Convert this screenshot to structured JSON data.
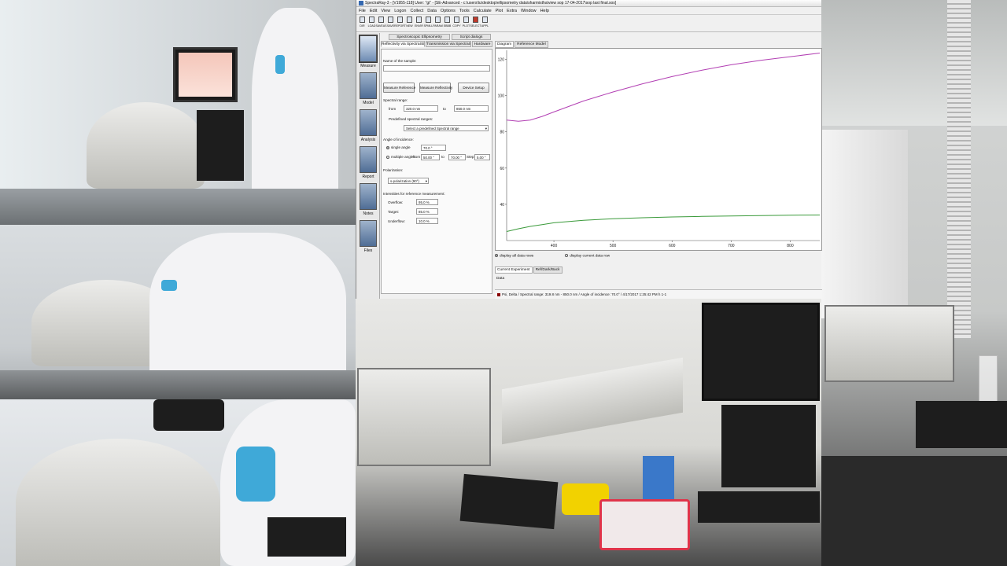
{
  "window": {
    "title": "SpectraRay-3 - [V1955-118] User: \"gi\" - [SE-Advanced - c:\\users\\lu\\desktop\\ellipsometry data\\sharmistha\\view sop 17-04-2017\\sop last final.sos]"
  },
  "menu": [
    "File",
    "Edit",
    "View",
    "Logon",
    "Collect",
    "Data",
    "Options",
    "Tools",
    "Calculate",
    "Plot",
    "Extra",
    "Window",
    "Help"
  ],
  "toolbar": [
    {
      "label": "DIR",
      "icon": "folder-icon"
    },
    {
      "label": "LOAD",
      "icon": "load-icon"
    },
    {
      "label": "SAVEAS",
      "icon": "save-as-icon"
    },
    {
      "label": "SAVE",
      "icon": "save-icon"
    },
    {
      "label": "REPORT",
      "icon": "report-icon"
    },
    {
      "label": "NEW",
      "icon": "new-icon"
    },
    {
      "label": "ENVIR",
      "icon": "environment-icon"
    },
    {
      "label": "SPMLL",
      "icon": "sample-icon"
    },
    {
      "label": "PARAM",
      "icon": "parameter-icon"
    },
    {
      "label": "EBBB",
      "icon": "ebbb-icon"
    },
    {
      "label": "COPY",
      "icon": "copy-icon"
    },
    {
      "label": "PLOT",
      "icon": "plot-icon"
    },
    {
      "label": "SELECT",
      "icon": "select-icon"
    },
    {
      "label": "APPL",
      "icon": "apply-icon"
    }
  ],
  "sidebar": [
    {
      "label": "Measure",
      "icon": "measure-icon"
    },
    {
      "label": "Model",
      "icon": "model-icon"
    },
    {
      "label": "Analysis",
      "icon": "analysis-icon"
    },
    {
      "label": "Report",
      "icon": "report-icon"
    },
    {
      "label": "Notes",
      "icon": "notes-icon"
    },
    {
      "label": "Files",
      "icon": "files-icon"
    }
  ],
  "tabs": {
    "row1": [
      "Spectroscopic Ellipsometry",
      "Script dialogs"
    ],
    "row2": [
      "Reflectivity via SpectraSB",
      "Transmission via SpectraSB",
      "Hardware"
    ]
  },
  "form": {
    "name_label": "Name of the sample:",
    "measure_reference": "Measure Reference",
    "measure_reflectivity": "Measure Reflectivity",
    "device_setup": "Device Setup",
    "spectral_range_label": "Spectral range:",
    "from_label": "from",
    "from_value": "320.0 nm",
    "to_label": "to",
    "to_value": "850.0 nm",
    "predefined_label": "Predefined spectral ranges:",
    "predefined_select": "Select a predefined Spectral range",
    "angle_label": "Angle of incidence:",
    "single_angle": "single angle",
    "single_value": "70.0 °",
    "multiple_angles": "multiple angles",
    "multi_from": "50.00 °",
    "multi_to": "70.00 °",
    "step_label": "Step:",
    "step_value": "5.00 °",
    "polarization_label": "Polarization:",
    "polarization_value": "s-polarization (90°)",
    "intensities_label": "Intensities for reference measurement:",
    "overflow_label": "Overflow:",
    "overflow_value": "95.0 %",
    "target_label": "Target:",
    "target_value": "85.0 %",
    "underflow_label": "Underflow:",
    "underflow_value": "10.0 %"
  },
  "diagram_tabs": [
    "Diagram",
    "Reference Model"
  ],
  "display_options": [
    "display all data rows",
    "display current data row"
  ],
  "lower_tabs": [
    "Current Experiment",
    "Ref/Dark/Back"
  ],
  "data_label": "Data",
  "status": "Psi, Delta / Spectral range: 319.8 nm - 850.0 nm / Angle of incidence: 70.0° / 4/17/2017 1:25:42 PM h 1-1",
  "colors": {
    "series_magenta": "#b23fb3",
    "series_green": "#3a9a3a",
    "status_swatch": "#800000"
  },
  "chart_data": {
    "type": "line",
    "xlim": [
      320,
      850
    ],
    "ylim": [
      20,
      125
    ],
    "x_ticks": [
      400,
      500,
      600,
      700,
      800
    ],
    "y_ticks": [
      40,
      60,
      80,
      100,
      120
    ],
    "grid": false,
    "series": [
      {
        "x": [
          320,
          340,
          360,
          380,
          400,
          450,
          500,
          550,
          600,
          650,
          700,
          750,
          800,
          850
        ],
        "y": [
          86.5,
          85.8,
          86.5,
          88.5,
          91,
          97,
          102,
          106.5,
          110.5,
          114,
          117,
          119.5,
          121.5,
          123.5
        ]
      },
      {
        "x": [
          320,
          340,
          360,
          380,
          400,
          450,
          500,
          550,
          600,
          650,
          700,
          750,
          800,
          850
        ],
        "y": [
          25,
          26.5,
          27.8,
          28.8,
          29.8,
          31.2,
          32,
          32.6,
          33,
          33.3,
          33.6,
          33.8,
          34,
          34.1
        ]
      }
    ]
  }
}
